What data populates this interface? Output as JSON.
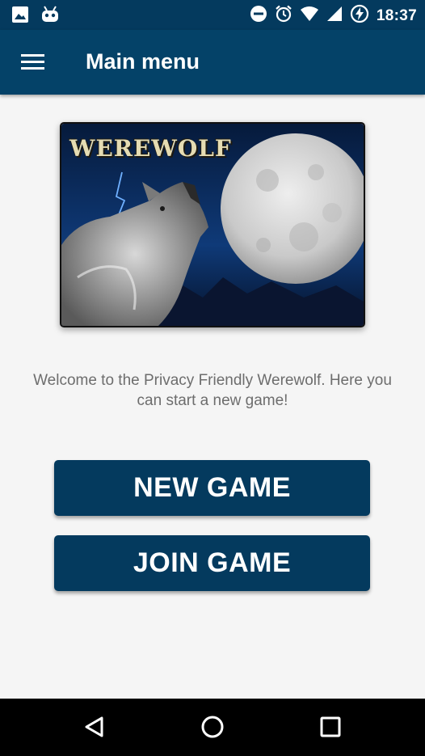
{
  "status_bar": {
    "time": "18:37",
    "icons_left": [
      "image-icon",
      "android-debug-icon"
    ],
    "icons_right": [
      "do-not-disturb-icon",
      "alarm-icon",
      "wifi-icon",
      "cell-signal-icon",
      "battery-charging-icon"
    ]
  },
  "app_bar": {
    "title": "Main menu",
    "menu_icon": "hamburger-menu-icon"
  },
  "banner": {
    "logo_text": "WEREWOLF"
  },
  "main": {
    "welcome_text": "Welcome to the Privacy Friendly Werewolf. Here you can start a new game!",
    "new_game_label": "NEW GAME",
    "join_game_label": "JOIN GAME"
  },
  "nav_bar": {
    "icons": [
      "back-icon",
      "home-icon",
      "recents-icon"
    ]
  },
  "colors": {
    "status_bar": "#043a5e",
    "app_bar": "#044268",
    "button": "#043a5e",
    "background": "#f5f5f5",
    "welcome_text": "#6d6d6d"
  }
}
